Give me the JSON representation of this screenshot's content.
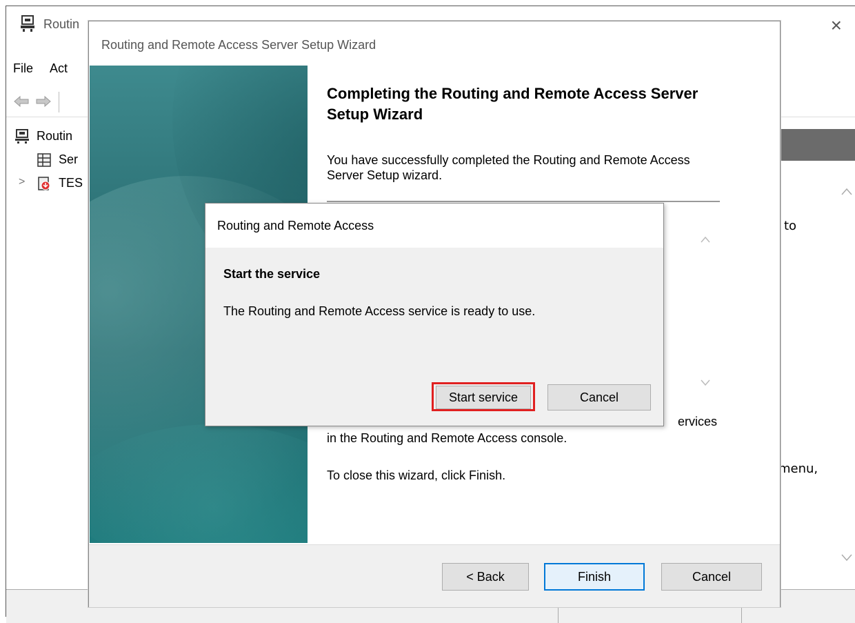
{
  "background_window": {
    "title": "Routin",
    "close_glyph": "×",
    "menu": [
      "File",
      "Act"
    ],
    "tree": {
      "root": "Routin",
      "server_status": "Ser",
      "server": "TES",
      "expander": ">"
    },
    "right_pane_text": [
      "to",
      "menu,"
    ],
    "scroll_up": "^",
    "scroll_down": "v"
  },
  "wizard": {
    "title": "Routing and Remote Access Server Setup Wizard",
    "heading": "Completing the Routing and Remote Access Server Setup Wizard",
    "body1": "You have successfully completed the Routing and Remote Access Server Setup wizard.",
    "body2_line1": "ervices",
    "body2_line2": "in the Routing and  Remote Access console.",
    "body3": "To close this wizard, click Finish.",
    "buttons": {
      "back": "< Back",
      "finish": "Finish",
      "cancel": "Cancel"
    }
  },
  "msgbox": {
    "title": "Routing and Remote Access",
    "heading": "Start the service",
    "text": "The Routing and Remote Access service is ready to use.",
    "buttons": {
      "start": "Start service",
      "cancel": "Cancel"
    }
  },
  "colors": {
    "highlight": "#e02020",
    "default_button_border": "#0078d7",
    "banner_teal": "#2f7579"
  }
}
